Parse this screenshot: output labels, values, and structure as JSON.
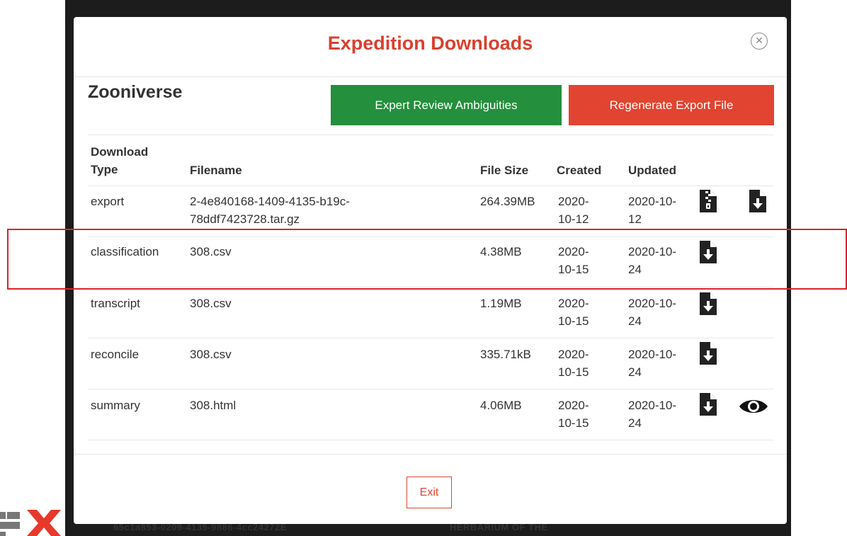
{
  "modal": {
    "title": "Expedition Downloads",
    "close_icon": "close-circle-icon",
    "project_name": "Zooniverse",
    "expert_review_label": "Expert Review Ambiguities",
    "regenerate_label": "Regenerate Export File",
    "exit_label": "Exit"
  },
  "colors": {
    "title": "#d9402f",
    "green_button": "#248f3c",
    "red_button": "#e14431",
    "highlight": "#d8232a"
  },
  "table": {
    "headers": {
      "type_line1": "Download",
      "type_line2": "Type",
      "filename": "Filename",
      "size": "File Size",
      "created": "Created",
      "updated": "Updated"
    },
    "rows": [
      {
        "type": "export",
        "filename_line1": "2-4e840168-1409-4135-b19c-",
        "filename_line2": "78ddf7423728.tar.gz",
        "size": "264.39MB",
        "created_line1": "2020-",
        "created_line2": "10-12",
        "updated_line1": "2020-10-",
        "updated_line2": "12",
        "icons": [
          "zip-file-icon",
          "download-file-icon"
        ]
      },
      {
        "type": "classification",
        "filename_line1": "308.csv",
        "filename_line2": "",
        "size": "4.38MB",
        "created_line1": "2020-",
        "created_line2": "10-15",
        "updated_line1": "2020-10-",
        "updated_line2": "24",
        "icons": [
          "download-file-icon"
        ]
      },
      {
        "type": "transcript",
        "filename_line1": "308.csv",
        "filename_line2": "",
        "size": "1.19MB",
        "created_line1": "2020-",
        "created_line2": "10-15",
        "updated_line1": "2020-10-",
        "updated_line2": "24",
        "icons": [
          "download-file-icon"
        ]
      },
      {
        "type": "reconcile",
        "filename_line1": "308.csv",
        "filename_line2": "",
        "size": "335.71kB",
        "created_line1": "2020-",
        "created_line2": "10-15",
        "updated_line1": "2020-10-",
        "updated_line2": "24",
        "icons": [
          "download-file-icon"
        ]
      },
      {
        "type": "summary",
        "filename_line1": "308.html",
        "filename_line2": "",
        "size": "4.06MB",
        "created_line1": "2020-",
        "created_line2": "10-15",
        "updated_line1": "2020-10-",
        "updated_line2": "24",
        "icons": [
          "download-file-icon",
          "eye-icon"
        ]
      }
    ]
  },
  "backdrop": {
    "text_left": "65c1a853-0209-4135-9886-4cc24272E",
    "text_right": "HERBARIUM OF THE"
  }
}
